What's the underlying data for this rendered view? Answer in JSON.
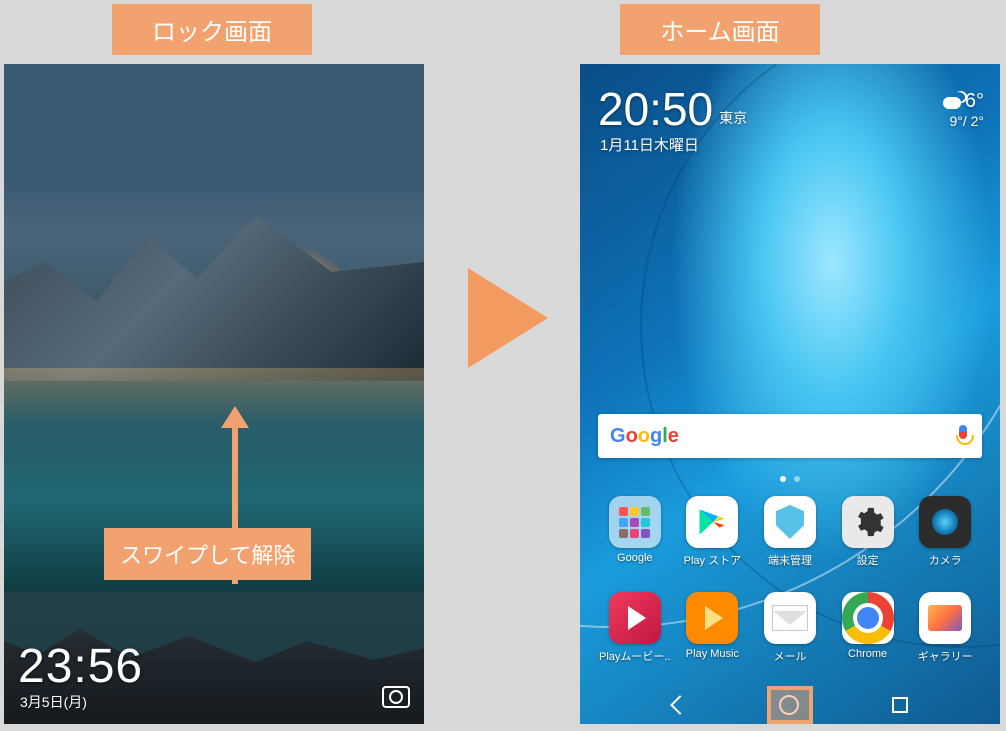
{
  "labels": {
    "lock_screen": "ロック画面",
    "home_screen": "ホーム画面",
    "swipe_hint": "スワイプして解除"
  },
  "lock": {
    "time": "23:56",
    "date": "3月5日(月)"
  },
  "home": {
    "time": "20:50",
    "city": "東京",
    "date": "1月11日木曜日",
    "weather": {
      "icon": "night-cloudy",
      "temp": "6°",
      "range": "9°/ 2°"
    },
    "search": {
      "brand": "Google"
    },
    "apps_row1": [
      {
        "name": "google-folder",
        "label": "Google",
        "ic": "ic-folder"
      },
      {
        "name": "play-store",
        "label": "Play ストア",
        "ic": "ic-play"
      },
      {
        "name": "phone-manager",
        "label": "端末管理",
        "ic": "ic-shield"
      },
      {
        "name": "settings",
        "label": "設定",
        "ic": "ic-gear"
      },
      {
        "name": "camera",
        "label": "カメラ",
        "ic": "ic-cam"
      }
    ],
    "apps_row2": [
      {
        "name": "play-movies",
        "label": "Playムービー..",
        "ic": "ic-movies"
      },
      {
        "name": "play-music",
        "label": "Play Music",
        "ic": "ic-music"
      },
      {
        "name": "mail",
        "label": "メール",
        "ic": "ic-mail"
      },
      {
        "name": "chrome",
        "label": "Chrome",
        "ic": "ic-chrome"
      },
      {
        "name": "gallery",
        "label": "ギャラリー",
        "ic": "ic-gallery"
      }
    ]
  }
}
